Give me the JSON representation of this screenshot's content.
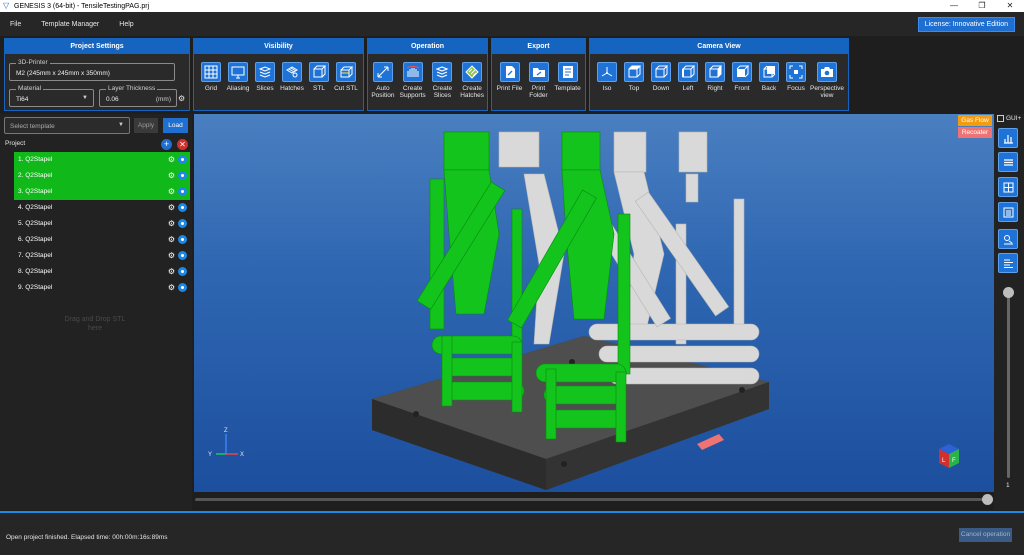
{
  "window": {
    "title": "GENESIS 3 (64-bit) - TensileTestingPAG.prj",
    "minimize": "—",
    "restore": "❐",
    "close": "✕"
  },
  "menu": [
    "File",
    "Template Manager",
    "Help"
  ],
  "license_label": "License: Innovative Edition",
  "project_settings": {
    "header": "Project Settings",
    "printer_label": "3D-Printer",
    "printer_value": "M2 (245mm x 245mm x 350mm)",
    "material_label": "Material",
    "material_value": "Ti64",
    "layer_label": "Layer Thickness",
    "layer_value": "0.06",
    "layer_unit": "(mm)"
  },
  "panels": {
    "visibility": {
      "header": "Visibility",
      "tools": [
        {
          "label": "Grid",
          "icon": "grid-icon"
        },
        {
          "label": "Aliasing",
          "icon": "monitor-icon"
        },
        {
          "label": "Slices",
          "icon": "slices-icon"
        },
        {
          "label": "Hatches",
          "icon": "hatches-icon"
        },
        {
          "label": "STL",
          "icon": "cube-icon"
        },
        {
          "label": "Cut STL",
          "icon": "cut-cube-icon"
        }
      ]
    },
    "operation": {
      "header": "Operation",
      "tools": [
        {
          "label": "Auto Position",
          "icon": "auto-position-icon"
        },
        {
          "label": "Create Supports",
          "icon": "supports-icon"
        },
        {
          "label": "Create Slices",
          "icon": "create-slices-icon"
        },
        {
          "label": "Create Hatches",
          "icon": "create-hatches-icon"
        }
      ]
    },
    "export": {
      "header": "Export",
      "tools": [
        {
          "label": "Print File",
          "icon": "print-file-icon"
        },
        {
          "label": "Print Folder",
          "icon": "print-folder-icon"
        },
        {
          "label": "Template",
          "icon": "template-icon"
        }
      ]
    },
    "camera": {
      "header": "Camera View",
      "tools": [
        {
          "label": "Iso",
          "icon": "iso-view-icon"
        },
        {
          "label": "Top",
          "icon": "top-view-icon"
        },
        {
          "label": "Down",
          "icon": "down-view-icon"
        },
        {
          "label": "Left",
          "icon": "left-view-icon"
        },
        {
          "label": "Right",
          "icon": "right-view-icon"
        },
        {
          "label": "Front",
          "icon": "front-view-icon"
        },
        {
          "label": "Back",
          "icon": "back-view-icon"
        },
        {
          "label": "Focus",
          "icon": "focus-icon"
        },
        {
          "label": "Perspective view",
          "icon": "camera-icon"
        }
      ]
    }
  },
  "template": {
    "placeholder": "Select template",
    "apply": "Apply",
    "load": "Load"
  },
  "project": {
    "label": "Project",
    "items": [
      {
        "label": "1.  Q2Stapel",
        "selected": true
      },
      {
        "label": "2.  Q2Stapel",
        "selected": true
      },
      {
        "label": "3.  Q2Stapel",
        "selected": true
      },
      {
        "label": "4.  Q2Stapel",
        "selected": false
      },
      {
        "label": "5.  Q2Stapel",
        "selected": false
      },
      {
        "label": "6.  Q2Stapel",
        "selected": false
      },
      {
        "label": "7.  Q2Stapel",
        "selected": false
      },
      {
        "label": "8.  Q2Stapel",
        "selected": false
      },
      {
        "label": "9.  Q2Stapel",
        "selected": false
      }
    ],
    "dropzone": "Drag and Drop STL here"
  },
  "viewport": {
    "gas_flow": "Gas Flow",
    "recoater": "Recoater",
    "axis_z": "Z",
    "axis_y": "Y",
    "axis_x": "X",
    "cube_left": "L",
    "cube_front": "F"
  },
  "rightbar": {
    "gui_label": "GUI+",
    "buttons": [
      "bar-chart-icon",
      "list-icon",
      "grid-icon",
      "layers-icon",
      "settings-icon",
      "align-icon"
    ],
    "slider_value": "1"
  },
  "status": {
    "message": "Open project finished. Elapsed time: 00h:00m:16s:89ms",
    "cancel": "Cancel operation"
  },
  "colors": {
    "accent": "#1565c0",
    "selected_part": "#11b81a",
    "unselected_part": "#d9d9d9",
    "gas_flow": "#f39c12",
    "recoater": "#ef7373"
  }
}
